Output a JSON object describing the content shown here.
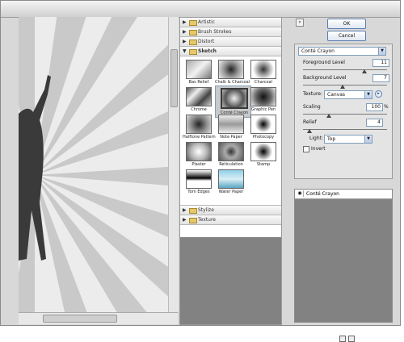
{
  "colors": {
    "window": "#d8d8d8",
    "panel_dark": "#828282",
    "button_border": "#5a7db0"
  },
  "gallery": {
    "categories_top": [
      {
        "label": "Artistic",
        "expanded": false
      },
      {
        "label": "Brush Strokes",
        "expanded": false
      },
      {
        "label": "Distort",
        "expanded": false
      },
      {
        "label": "Sketch",
        "expanded": true
      }
    ],
    "thumbnails": [
      {
        "label": "Bas Relief"
      },
      {
        "label": "Chalk & Charcoal"
      },
      {
        "label": "Charcoal"
      },
      {
        "label": "Chrome"
      },
      {
        "label": "Conté Crayon",
        "selected": true
      },
      {
        "label": "Graphic Pen"
      },
      {
        "label": "Halftone Pattern"
      },
      {
        "label": "Note Paper"
      },
      {
        "label": "Photocopy"
      },
      {
        "label": "Plaster"
      },
      {
        "label": "Reticulation"
      },
      {
        "label": "Stamp"
      },
      {
        "label": "Torn Edges"
      },
      {
        "label": "Water Paper"
      }
    ],
    "categories_bottom": [
      {
        "label": "Stylize",
        "expanded": false
      },
      {
        "label": "Texture",
        "expanded": false
      }
    ]
  },
  "buttons": {
    "ok": "OK",
    "cancel": "Cancel"
  },
  "filter_select": {
    "value": "Conté Crayon"
  },
  "params": {
    "foreground_label": "Foreground Level",
    "foreground_value": "11",
    "background_label": "Background Level",
    "background_value": "7",
    "texture_label": "Texture:",
    "texture_value": "Canvas",
    "scaling_label": "Scaling",
    "scaling_value": "100",
    "scaling_unit": "%",
    "relief_label": "Relief",
    "relief_value": "4",
    "light_label": "Light:",
    "light_value": "Top",
    "invert_label": "Invert",
    "invert_checked": false
  },
  "sliders": {
    "foreground": 0.73,
    "background": 0.47,
    "scaling": 0.31,
    "relief": 0.08
  },
  "layers": {
    "items": [
      {
        "name": "Conté Crayon",
        "visible": true
      }
    ]
  }
}
